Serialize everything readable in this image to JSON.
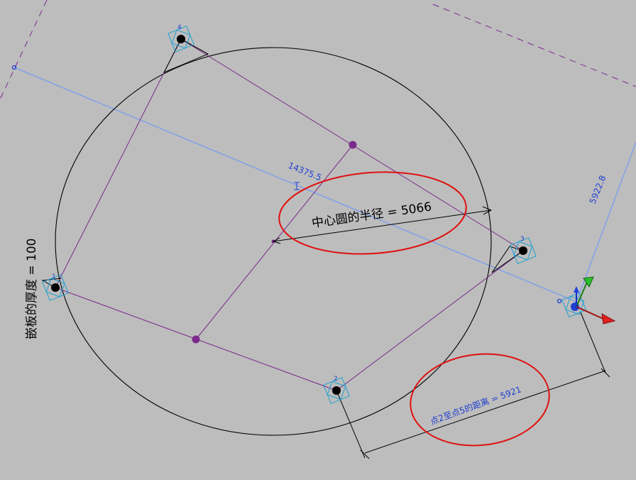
{
  "annotations": {
    "radius_label": "中心圆的半径 = 5066",
    "thickness_label": "嵌板的厚度 = 100",
    "distance_label": "点2至点5的距离 = 5921",
    "dim_long": "14375.5",
    "dim_short": "5922.8"
  },
  "points": {
    "p1": "1",
    "p2": "2",
    "p3": "3",
    "p4": "4"
  },
  "colors": {
    "background": "#bdbdbd",
    "geometry": "#000000",
    "purple_lines": "#7a2b8c",
    "blue_reference": "#7a9cf0",
    "dimension_text": "#1f3fd0",
    "highlight_ellipse": "#e01010",
    "point_marker": "#20a0d0"
  }
}
